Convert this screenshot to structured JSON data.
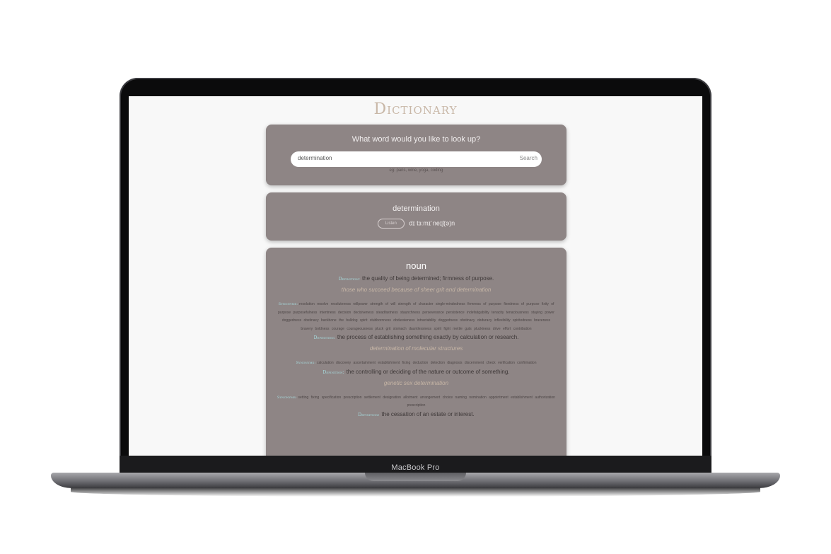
{
  "device": {
    "label": "MacBook Pro"
  },
  "app": {
    "title": "Dictionary"
  },
  "search": {
    "prompt": "What word would you like to look up?",
    "value": "determination",
    "button": "Search",
    "hint": "eg: paris, wine, yoga, coding"
  },
  "result": {
    "word": "determination",
    "listen": "Listen",
    "phonetic": "dɪ tɜːmɪˈneɪʃ(ə)n"
  },
  "meaning": {
    "part_of_speech": "noun",
    "definition_label": "Definition:",
    "synonyms_label": "Synonyms:",
    "entries": [
      {
        "definition": "the quality of being determined; firmness of purpose.",
        "example": "those who succeed because of sheer grit and determination",
        "synonyms": "resolution resolve resoluteness willpower strength of will strength of character single-mindedness firmness of purpose fixedness of purpose fixity of purpose purposefulness intentness decision decisiveness steadfastness staunchness perseverance persistence indefatigability tenacity tenaciousness staying power doggedness obstinacy backbone the bulldog spirit stubbornness obdurateness intractability doggedness obstinacy obduracy inflexibility spiritedness braveness bravery boldness courage courageousness pluck grit stomach dauntlessness spirit fight mettle guts pluckiness drive effort contribution"
      },
      {
        "definition": "the process of establishing something exactly by calculation or research.",
        "example": "determination of molecular structures",
        "synonyms": "calculation discovery ascertainment establishment fixing deduction detection diagnosis discernment check verification confirmation"
      },
      {
        "definition": "the controlling or deciding of the nature or outcome of something.",
        "example": "genetic sex determination",
        "synonyms": "setting fixing specification prescription settlement designation allotment arrangement choice naming nomination appointment establishment authorization prescription"
      },
      {
        "definition": "the cessation of an estate or interest.",
        "example": "",
        "synonyms": ""
      }
    ]
  }
}
